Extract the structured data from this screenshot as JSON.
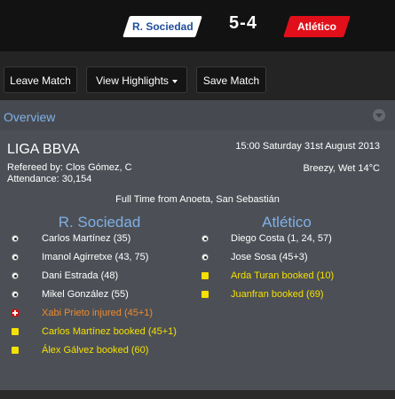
{
  "scoreboard": {
    "home_team": "R. Sociedad",
    "away_team": "Atlético",
    "score": "5-4",
    "home_color": "#ffffff",
    "away_color": "#e10f1a"
  },
  "toolbar": {
    "leave_label": "Leave Match",
    "highlights_label": "View Highlights",
    "save_label": "Save Match"
  },
  "overview": {
    "title": "Overview",
    "league": "LIGA BBVA",
    "referee": "Refereed by: Clos Gómez, C",
    "attendance": "Attendance: 30,154",
    "datetime": "15:00 Saturday 31st August 2013",
    "weather": "Breezy, Wet 14°C",
    "fulltime": "Full Time from Anoeta, San Sebastián"
  },
  "home": {
    "name": "R. Sociedad",
    "events": [
      {
        "type": "goal",
        "text": "Carlos Martínez (35)",
        "color": "white"
      },
      {
        "type": "goal",
        "text": "Imanol Agirretxe (43, 75)",
        "color": "white"
      },
      {
        "type": "goal",
        "text": "Dani Estrada (48)",
        "color": "white"
      },
      {
        "type": "goal",
        "text": "Mikel González (55)",
        "color": "white"
      },
      {
        "type": "injury",
        "text": "Xabi Prieto injured (45+1)",
        "color": "orange"
      },
      {
        "type": "yellow",
        "text": "Carlos Martínez booked (45+1)",
        "color": "yellow"
      },
      {
        "type": "yellow",
        "text": "Álex Gálvez booked (60)",
        "color": "yellow"
      }
    ]
  },
  "away": {
    "name": "Atlético",
    "events": [
      {
        "type": "goal",
        "text": "Diego Costa (1, 24, 57)",
        "color": "white"
      },
      {
        "type": "goal",
        "text": "Jose Sosa (45+3)",
        "color": "white"
      },
      {
        "type": "yellow",
        "text": "Arda Turan booked (10)",
        "color": "yellow"
      },
      {
        "type": "yellow",
        "text": "Juanfran booked (69)",
        "color": "yellow"
      }
    ]
  },
  "icons": {
    "goal": "football-icon",
    "yellow": "yellow-card-icon",
    "injury": "injury-icon",
    "collapse": "collapse-icon",
    "dropdown": "caret-down-icon"
  }
}
